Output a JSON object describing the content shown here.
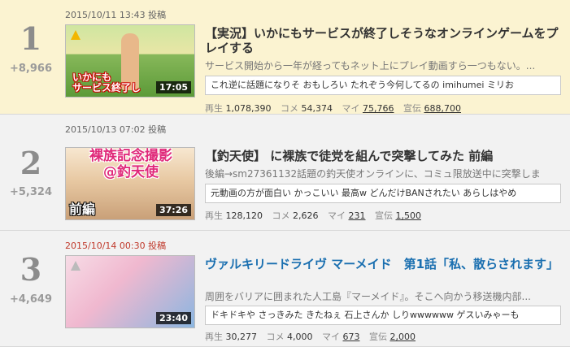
{
  "ranking": [
    {
      "rank": "1",
      "delta": "+8,966",
      "posted": "2015/10/11 13:43 投稿",
      "title": "【実況】いかにもサービスが終了しそうなオンラインゲームをプレイする",
      "description": "サービス開始から一年が経ってもネット上にプレイ動画すら一つもない。...",
      "comments": "これ逆に話題になりそ おもしろい たれぞう今何してるの imihumei ミリお",
      "thumbnail_text": "いかにも\nサービス終了し",
      "duration": "17:05",
      "stats": {
        "views_label": "再生",
        "views": "1,078,390",
        "comments_label": "コメ",
        "comments": "54,374",
        "mylist_label": "マイ",
        "mylist": "75,766",
        "ad_label": "宣伝",
        "ad": "688,700"
      }
    },
    {
      "rank": "2",
      "delta": "+5,324",
      "posted": "2015/10/13 07:02 投稿",
      "title": "【釣天使】 に裸族で徒党を組んで突撃してみた 前編",
      "description": "後編→sm27361132話題の釣天使オンラインに、コミュ限放送中に突撃しま",
      "comments": "元動画の方が面白い かっこいい 最高w どんだけBANされたい あらしはやめ",
      "thumbnail_text": "裸族記念撮影\n@釣天使",
      "thumbnail_text2": "前編",
      "duration": "37:26",
      "stats": {
        "views_label": "再生",
        "views": "128,120",
        "comments_label": "コメ",
        "comments": "2,626",
        "mylist_label": "マイ",
        "mylist": "231",
        "ad_label": "宣伝",
        "ad": "1,500"
      }
    },
    {
      "rank": "3",
      "delta": "+4,649",
      "posted": "2015/10/14 00:30 投稿",
      "title": "ヴァルキリードライヴ マーメイド　第1話「私、散らされます」",
      "description": "周囲をバリアに囲まれた人工島『マーメイド』。そこへ向かう移送機内部...",
      "comments": "ドキドキや さっきみた きたねぇ 石上さんか しりwwwwww ゲスいみゃーも",
      "duration": "23:40",
      "stats": {
        "views_label": "再生",
        "views": "30,277",
        "comments_label": "コメ",
        "comments": "4,000",
        "mylist_label": "マイ",
        "mylist": "673",
        "ad_label": "宣伝",
        "ad": "2,000"
      }
    }
  ],
  "colors": {
    "highlight_row": "#fbf3d1",
    "row": "#f2f2f2",
    "link": "#1a6fb0",
    "new_date": "#c0392b"
  }
}
